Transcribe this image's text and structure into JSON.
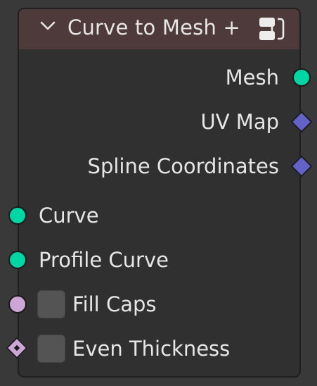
{
  "node": {
    "title": "Curve to Mesh +",
    "header_color": "#4e3a3b",
    "header_icons": [
      "chevron-down-icon",
      "node-group-icon"
    ]
  },
  "outputs": [
    {
      "label": "Mesh",
      "socket": "circle",
      "color": "#00d6a3"
    },
    {
      "label": "UV Map",
      "socket": "diamond",
      "color": "#6363c7"
    },
    {
      "label": "Spline Coordinates",
      "socket": "diamond",
      "color": "#6363c7"
    }
  ],
  "inputs": [
    {
      "label": "Curve",
      "socket": "circle",
      "color": "#00d6a3"
    },
    {
      "label": "Profile Curve",
      "socket": "circle",
      "color": "#00d6a3"
    },
    {
      "label": "Fill Caps",
      "socket": "circle",
      "color": "#cca6d6",
      "checkbox": false
    },
    {
      "label": "Even Thickness",
      "socket": "diamond-dot",
      "color": "#cca6d6",
      "checkbox": false
    }
  ]
}
